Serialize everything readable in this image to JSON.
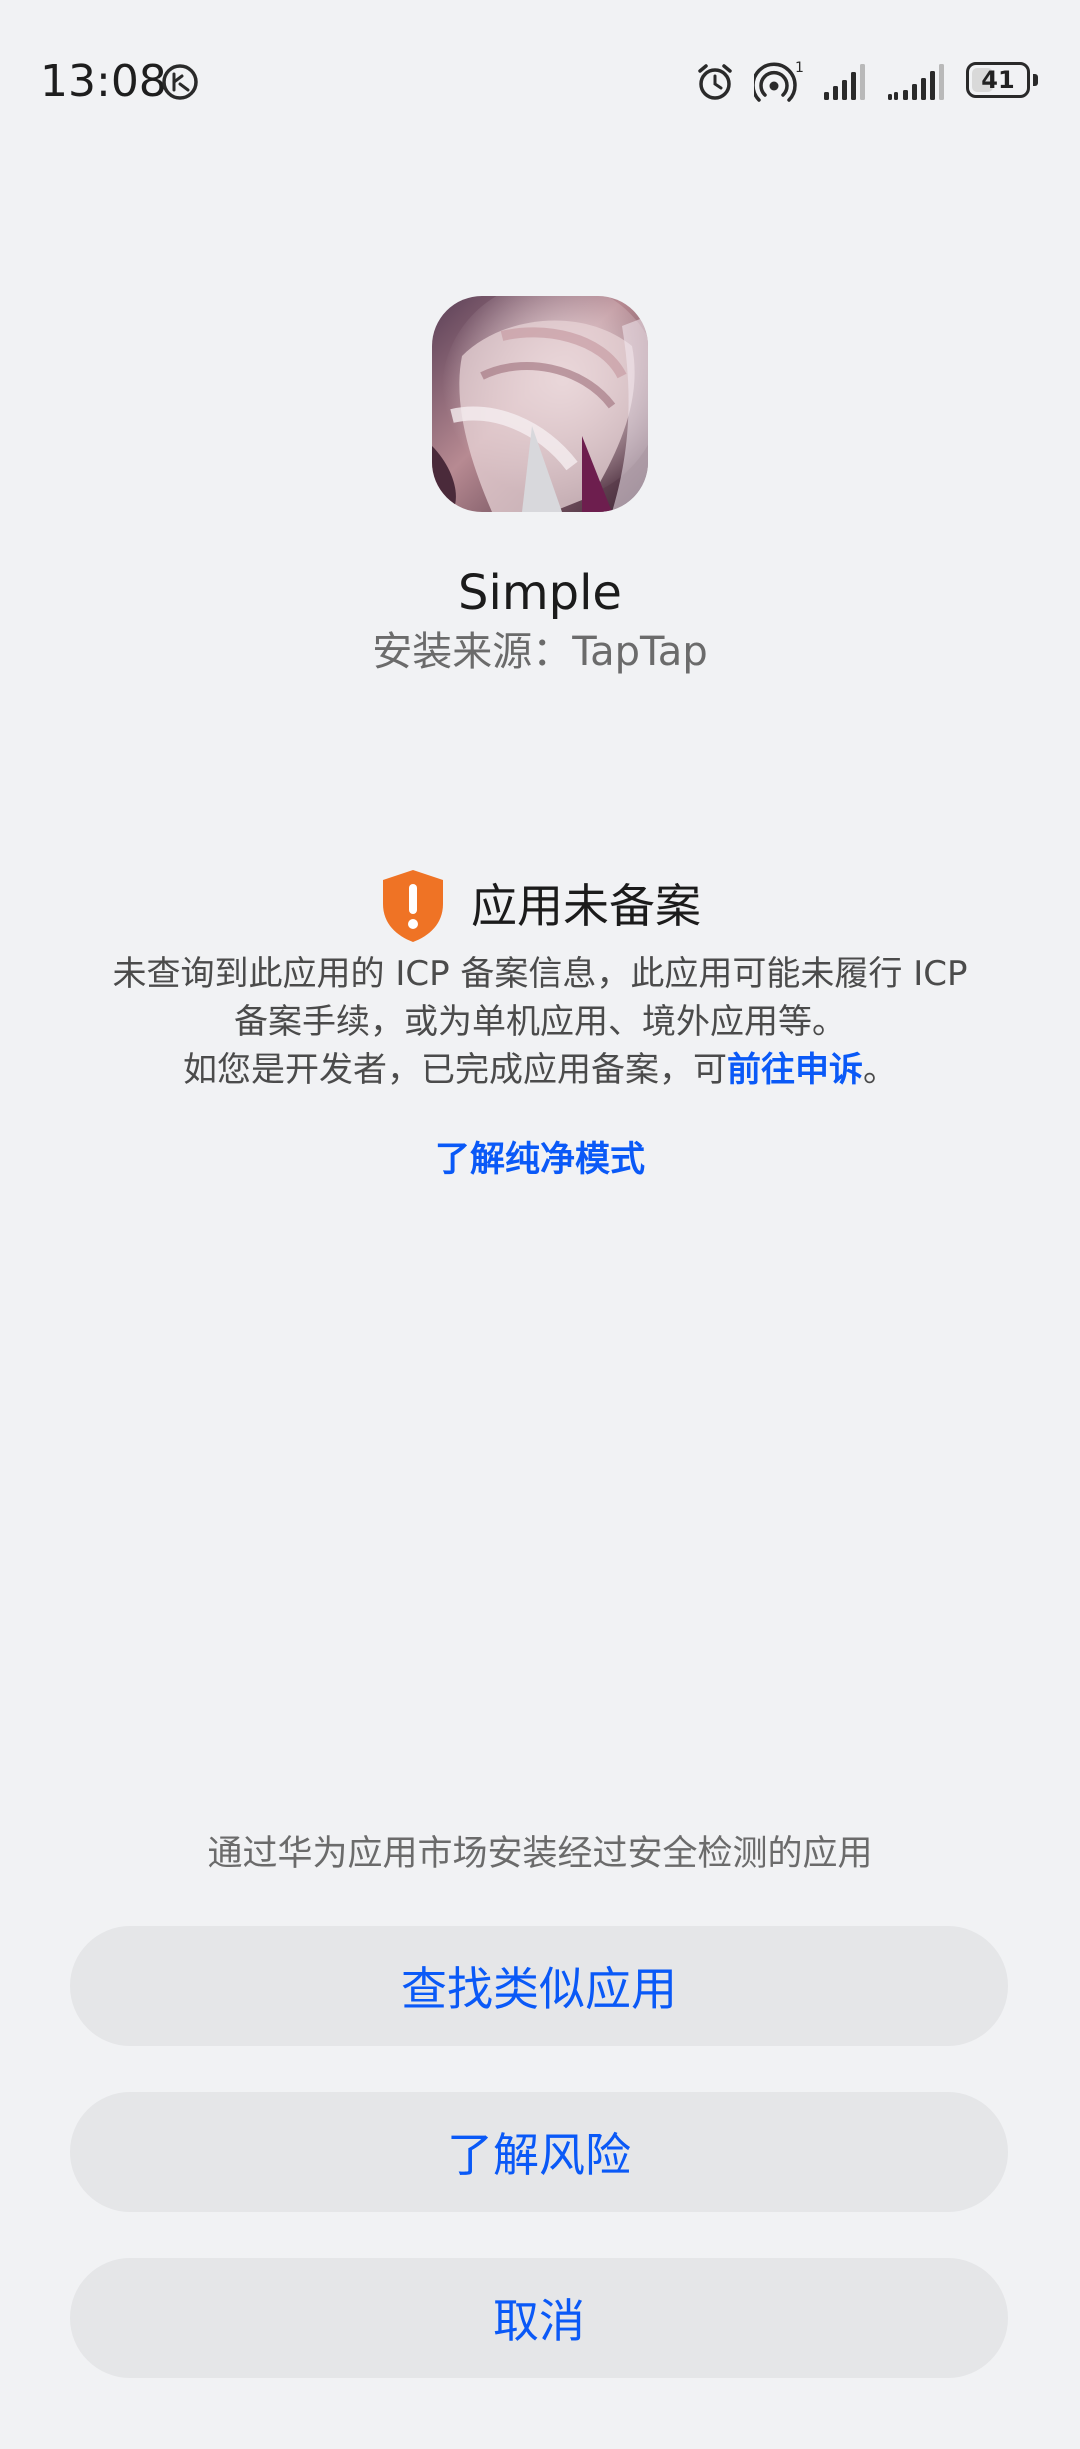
{
  "status_bar": {
    "time": "13:08",
    "battery_level": "41",
    "battery_fraction": 0.41,
    "icons": [
      "huawei-share-icon",
      "alarm-icon",
      "hotspot-icon",
      "signal-icon",
      "signal-icon-2",
      "battery-icon"
    ],
    "hotspot_count": "1"
  },
  "app": {
    "name": "Simple",
    "source": "安装来源：TapTap"
  },
  "warning": {
    "title": "应用未备案",
    "line1": "未查询到此应用的 ICP 备案信息，此应用可能未履行 ICP",
    "line2": "备案手续，或为单机应用、境外应用等。",
    "line3_prefix": "如您是开发者，已完成应用备案，可",
    "line3_link": "前往申诉",
    "line3_suffix": "。",
    "pure_mode_link": "了解纯净模式",
    "icon_color": "#ef7325"
  },
  "bottom": {
    "hint": "通过华为应用市场安装经过安全检测的应用",
    "find_similar": "查找类似应用",
    "learn_risk": "了解风险",
    "cancel": "取消"
  },
  "colors": {
    "background": "#f1f2f4",
    "accent": "#0a59f7",
    "button_bg": "#e5e6e8",
    "warning_orange": "#ef7325"
  }
}
